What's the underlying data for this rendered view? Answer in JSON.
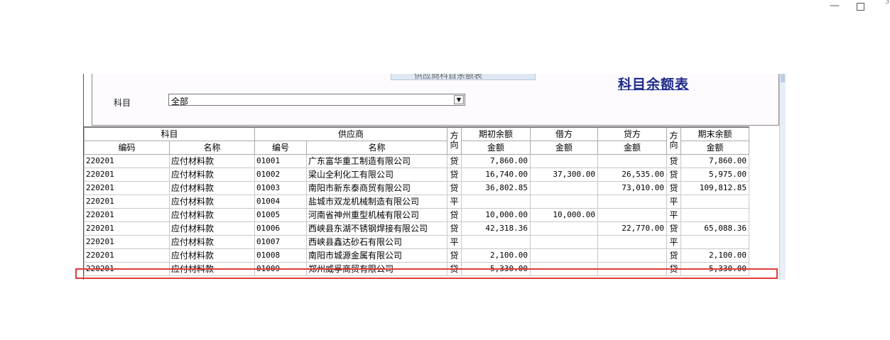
{
  "window": {
    "minimize_glyph": "—",
    "close_glyph": "3"
  },
  "toolbar": {
    "cut_button_label": "供应商科目余额表"
  },
  "report": {
    "title": "科目余额表"
  },
  "filter": {
    "subject_label": "科目",
    "subject_value": "全部"
  },
  "table": {
    "group_headers": {
      "subject": "科目",
      "supplier": "供应商",
      "direction": "方向",
      "opening": "期初余额",
      "debit": "借方",
      "credit": "贷方",
      "direction2": "方向",
      "closing": "期末余额"
    },
    "sub_headers": {
      "code": "编码",
      "name": "名称",
      "supplier_code": "编号",
      "supplier_name": "名称",
      "opening_amount": "金额",
      "debit_amount": "金额",
      "credit_amount": "金额",
      "closing_amount": "金额"
    },
    "rows": [
      {
        "code": "220201",
        "name": "应付材料款",
        "sup_code": "01001",
        "sup_name": "广东富华重工制造有限公司",
        "dir": "贷",
        "opening": "7,860.00",
        "debit": "",
        "credit": "",
        "dir2": "贷",
        "closing": "7,860.00"
      },
      {
        "code": "220201",
        "name": "应付材料款",
        "sup_code": "01002",
        "sup_name": "梁山全利化工有限公司",
        "dir": "贷",
        "opening": "16,740.00",
        "debit": "37,300.00",
        "credit": "26,535.00",
        "dir2": "贷",
        "closing": "5,975.00"
      },
      {
        "code": "220201",
        "name": "应付材料款",
        "sup_code": "01003",
        "sup_name": "南阳市新东泰商贸有限公司",
        "dir": "贷",
        "opening": "36,802.85",
        "debit": "",
        "credit": "73,010.00",
        "dir2": "贷",
        "closing": "109,812.85"
      },
      {
        "code": "220201",
        "name": "应付材料款",
        "sup_code": "01004",
        "sup_name": "盐城市双龙机械制造有限公司",
        "dir": "平",
        "opening": "",
        "debit": "",
        "credit": "",
        "dir2": "平",
        "closing": ""
      },
      {
        "code": "220201",
        "name": "应付材料款",
        "sup_code": "01005",
        "sup_name": "河南省神州重型机械有限公司",
        "dir": "贷",
        "opening": "10,000.00",
        "debit": "10,000.00",
        "credit": "",
        "dir2": "平",
        "closing": ""
      },
      {
        "code": "220201",
        "name": "应付材料款",
        "sup_code": "01006",
        "sup_name": "西峡县东湖不锈钢焊接有限公司",
        "dir": "贷",
        "opening": "42,318.36",
        "debit": "",
        "credit": "22,770.00",
        "dir2": "贷",
        "closing": "65,088.36"
      },
      {
        "code": "220201",
        "name": "应付材料款",
        "sup_code": "01007",
        "sup_name": "西峡县鑫达砂石有限公司",
        "dir": "平",
        "opening": "",
        "debit": "",
        "credit": "",
        "dir2": "平",
        "closing": ""
      },
      {
        "code": "220201",
        "name": "应付材料款",
        "sup_code": "01008",
        "sup_name": "南阳市城源金属有限公司",
        "dir": "贷",
        "opening": "2,100.00",
        "debit": "",
        "credit": "",
        "dir2": "贷",
        "closing": "2,100.00"
      },
      {
        "code": "220201",
        "name": "应付材料款",
        "sup_code": "01009",
        "sup_name": "郑州威孚商贸有限公司",
        "dir": "贷",
        "opening": "5,330.00",
        "debit": "",
        "credit": "",
        "dir2": "贷",
        "closing": "5,330.00"
      }
    ]
  },
  "colors": {
    "title": "#1c2a8a",
    "highlight": "#e03a3a"
  }
}
